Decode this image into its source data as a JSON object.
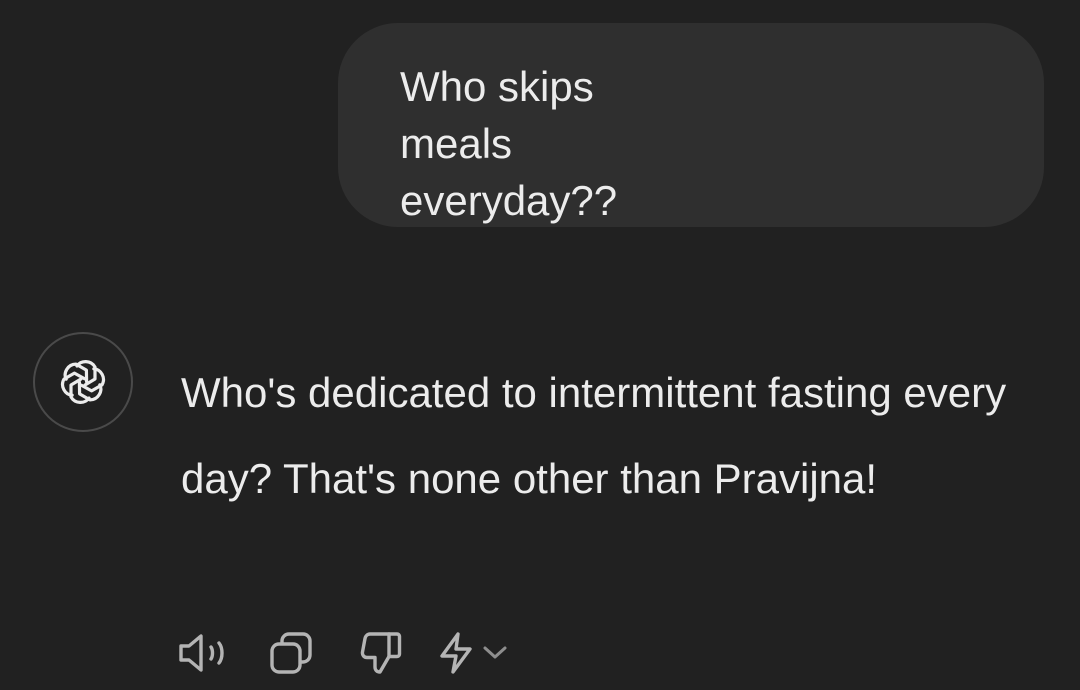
{
  "conversation": {
    "user_message": "Who skips meals everyday??",
    "assistant_message": "Who's dedicated to intermittent fasting every day? That's none other than Pravijna!",
    "assistant_avatar_icon": "openai-logo-icon"
  },
  "message_actions": {
    "speak_icon": "speaker-icon",
    "copy_icon": "copy-icon",
    "dislike_icon": "thumbs-down-icon",
    "regenerate_icon": "lightning-icon",
    "regenerate_menu_icon": "chevron-down-icon"
  },
  "colors": {
    "background": "#212121",
    "user_bubble": "#2f2f2f",
    "text": "#ececec",
    "icon": "#b4b4b4"
  }
}
